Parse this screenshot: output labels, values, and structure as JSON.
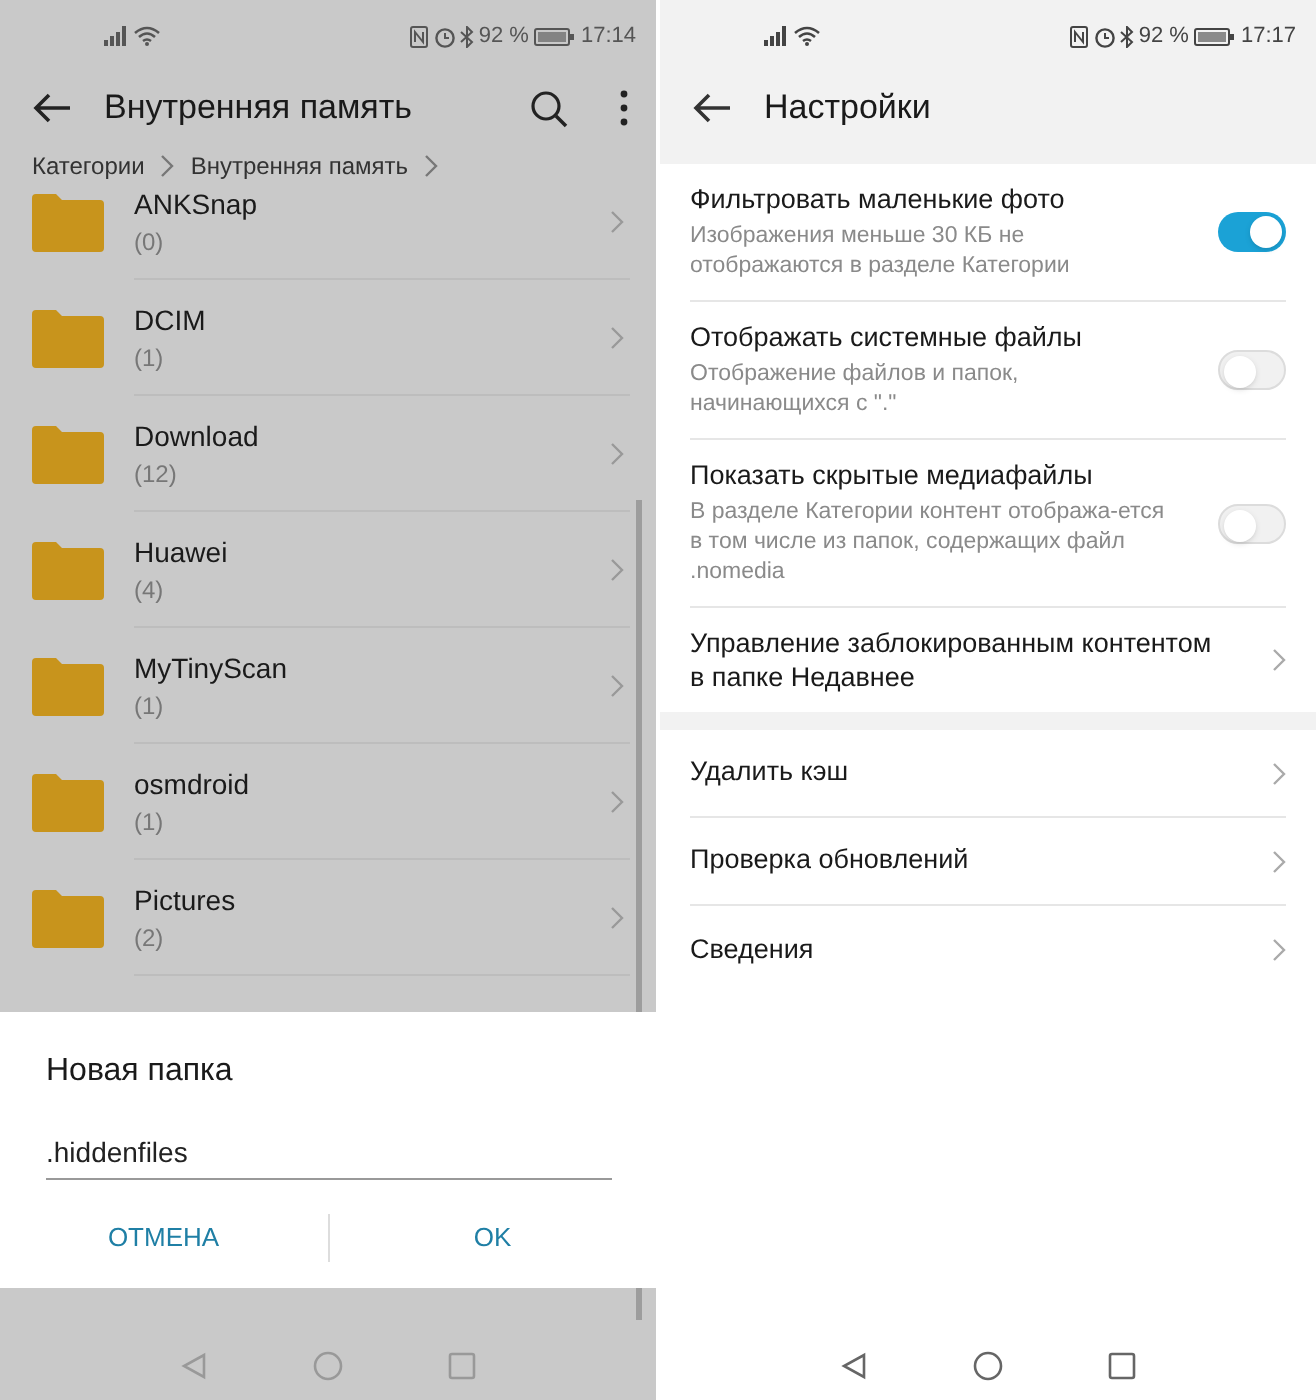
{
  "left_screen": {
    "status_bar": {
      "battery": "92 %",
      "time": "17:14"
    },
    "toolbar": {
      "title": "Внутренняя память"
    },
    "breadcrumbs": [
      {
        "label": "Категории"
      },
      {
        "label": "Внутренняя память"
      }
    ],
    "folders": [
      {
        "name": "ANKSnap",
        "count": "(0)"
      },
      {
        "name": "DCIM",
        "count": "(1)"
      },
      {
        "name": "Download",
        "count": "(12)"
      },
      {
        "name": "Huawei",
        "count": "(4)"
      },
      {
        "name": "MyTinyScan",
        "count": "(1)"
      },
      {
        "name": "osmdroid",
        "count": "(1)"
      },
      {
        "name": "Pictures",
        "count": "(2)"
      }
    ],
    "dialog": {
      "title": "Новая папка",
      "value": ".hiddenfiles",
      "buttons": [
        "ОТМЕНА",
        "OK"
      ]
    }
  },
  "right_screen": {
    "status_bar": {
      "battery": "92 %",
      "time": "17:17"
    },
    "toolbar": {
      "title": "Настройки"
    },
    "settings": [
      {
        "kind": "toggle",
        "title": "Фильтровать маленькие фото",
        "subtitle": "Изображения меньше 30 КБ не отображаются в разделе Категории",
        "on": true
      },
      {
        "kind": "toggle",
        "title": "Отображать системные файлы",
        "subtitle": "Отображение файлов и папок, начинающихся с \".\"",
        "on": false
      },
      {
        "kind": "toggle",
        "title": "Показать скрытые медиафайлы",
        "subtitle": "В разделе Категории контент отобража-ется в том числе из папок, содержащих файл .nomedia",
        "on": false
      },
      {
        "kind": "link",
        "title": "Управление заблокированным контентом в папке Недавнее"
      }
    ],
    "links": [
      {
        "title": "Удалить кэш"
      },
      {
        "title": "Проверка обновлений"
      },
      {
        "title": "Сведения"
      }
    ]
  }
}
